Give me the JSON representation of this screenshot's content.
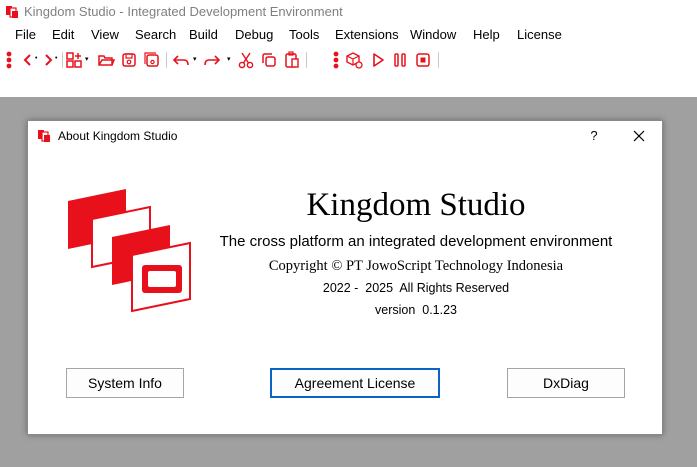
{
  "ide": {
    "title": "Kingdom Studio - Integrated Development Environment",
    "menu": [
      "File",
      "Edit",
      "View",
      "Search",
      "Build",
      "Debug",
      "Tools",
      "Extensions",
      "Window",
      "Help",
      "License"
    ]
  },
  "toolbar": {
    "icons": [
      "navigate-back-icon",
      "navigate-forward-icon",
      "new-item-icon",
      "open-folder-icon",
      "save-icon",
      "save-all-icon",
      "undo-icon",
      "redo-icon",
      "cut-icon",
      "copy-icon",
      "paste-icon",
      "build-package-icon",
      "run-icon",
      "pause-icon",
      "stop-icon"
    ]
  },
  "dialog": {
    "title": "About Kingdom Studio",
    "help_glyph": "?",
    "product_name": "Kingdom Studio",
    "tagline": "The cross platform an integrated development environment",
    "copyright": "Copyright © PT JowoScript Technology Indonesia",
    "years": "2022 -  2025  All Rights Reserved",
    "version": "version  0.1.23",
    "buttons": {
      "system_info": "System Info",
      "agreement_license": "Agreement License",
      "dxdiag": "DxDiag"
    }
  },
  "colors": {
    "accent": "#e8111b",
    "background": "#a0a0a0",
    "default_button_border": "#0a64c8"
  }
}
